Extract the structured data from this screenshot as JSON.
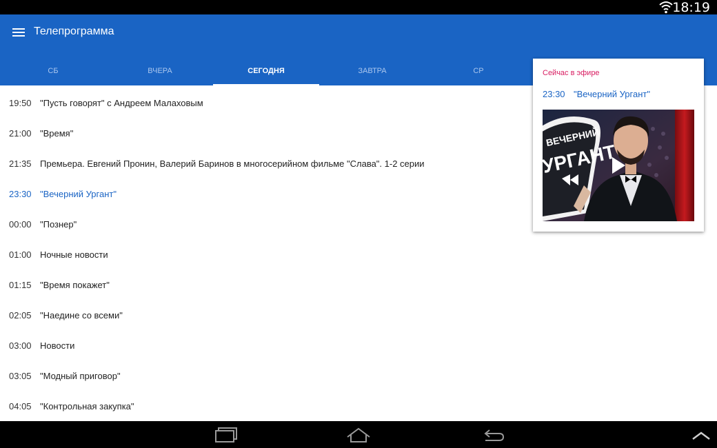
{
  "status_bar": {
    "clock": "18:19",
    "wifi_icon": "wifi-icon"
  },
  "app_bar": {
    "menu_icon": "hamburger-menu-icon",
    "title": "Телепрограмма"
  },
  "tabs": [
    {
      "label": "СБ",
      "active": false
    },
    {
      "label": "ВЧЕРА",
      "active": false
    },
    {
      "label": "СЕГОДНЯ",
      "active": true
    },
    {
      "label": "ЗАВТРА",
      "active": false
    },
    {
      "label": "СР",
      "active": false
    }
  ],
  "programs": [
    {
      "time": "19:50",
      "title": "\"Пусть говорят\" с Андреем Малаховым"
    },
    {
      "time": "21:00",
      "title": "\"Время\""
    },
    {
      "time": "21:35",
      "title": "Премьера. Евгений Пронин, Валерий Баринов в многосерийном фильме \"Слава\". 1-2 серии"
    },
    {
      "time": "23:30",
      "title": "\"Вечерний Ургант\"",
      "current": true
    },
    {
      "time": "00:00",
      "title": "\"Познер\""
    },
    {
      "time": "01:00",
      "title": "Ночные новости"
    },
    {
      "time": "01:15",
      "title": "\"Время покажет\""
    },
    {
      "time": "02:05",
      "title": "\"Наедине со всеми\""
    },
    {
      "time": "03:00",
      "title": "Новости"
    },
    {
      "time": "03:05",
      "title": "\"Модный приговор\""
    },
    {
      "time": "04:05",
      "title": "\"Контрольная закупка\""
    }
  ],
  "now_on_air": {
    "label": "Сейчас в эфире",
    "time": "23:30",
    "title": "\"Вечерний Ургант\"",
    "logo_text_line1": "ВЕЧЕРНИЙ",
    "logo_text_line2": "УРГАНТ",
    "play_icon": "play-icon"
  },
  "nav_bar": {
    "icons": [
      "recent-apps-icon",
      "home-icon",
      "back-icon",
      "collapse-icon"
    ]
  },
  "colors": {
    "primary": "#1a64c4",
    "accent": "#d81b60",
    "status_bar": "#000000"
  }
}
